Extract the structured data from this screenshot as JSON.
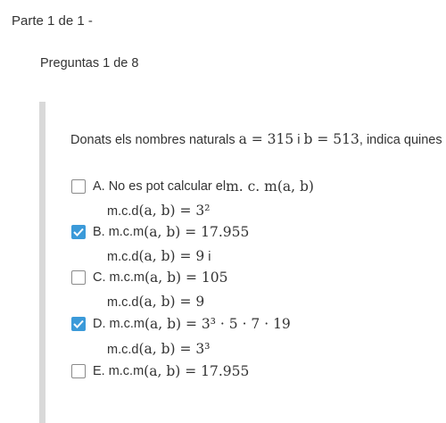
{
  "header": {
    "part_title": "Parte 1 de 1 -",
    "question_count": "Preguntas 1 de 8"
  },
  "question": {
    "prompt_before": "Donats els nombres naturals ",
    "a_expr": "a = 315",
    "joiner": " i ",
    "b_expr": "b = 513",
    "prompt_after": ", indica quines d"
  },
  "options": [
    {
      "letter": "A.",
      "text": "No es pot calcular el ",
      "math": "m. c. m(a, b)",
      "checked": false
    },
    {
      "letter": "B.",
      "text": "m.c.m",
      "math": "(a, b) = 17.955",
      "checked": true
    },
    {
      "letter": "C.",
      "text": "m.c.m",
      "math": "(a, b) = 105",
      "checked": false
    },
    {
      "letter": "D.",
      "text": "m.c.m",
      "math": "(a, b) = 3³ · 5 · 7 · 19",
      "checked": true
    },
    {
      "letter": "E.",
      "text": "m.c.m",
      "math": "(a, b) = 17.955",
      "checked": false
    }
  ],
  "sublines": [
    {
      "text": "m.c.d",
      "math": "(a, b) = 3²",
      "suffix": ""
    },
    {
      "text": "m.c.d",
      "math": "(a, b) = 9",
      "suffix": " i"
    },
    {
      "text": "m.c.d",
      "math": "(a, b) = 9",
      "suffix": ""
    },
    {
      "text": "m.c.d",
      "math": "(a, b) = 3³",
      "suffix": ""
    }
  ],
  "colors": {
    "checkbox_checked": "#3b9ad9",
    "panel_border": "#d9d9d9",
    "text": "#333333"
  },
  "icons": {
    "checkmark": "check-icon"
  }
}
